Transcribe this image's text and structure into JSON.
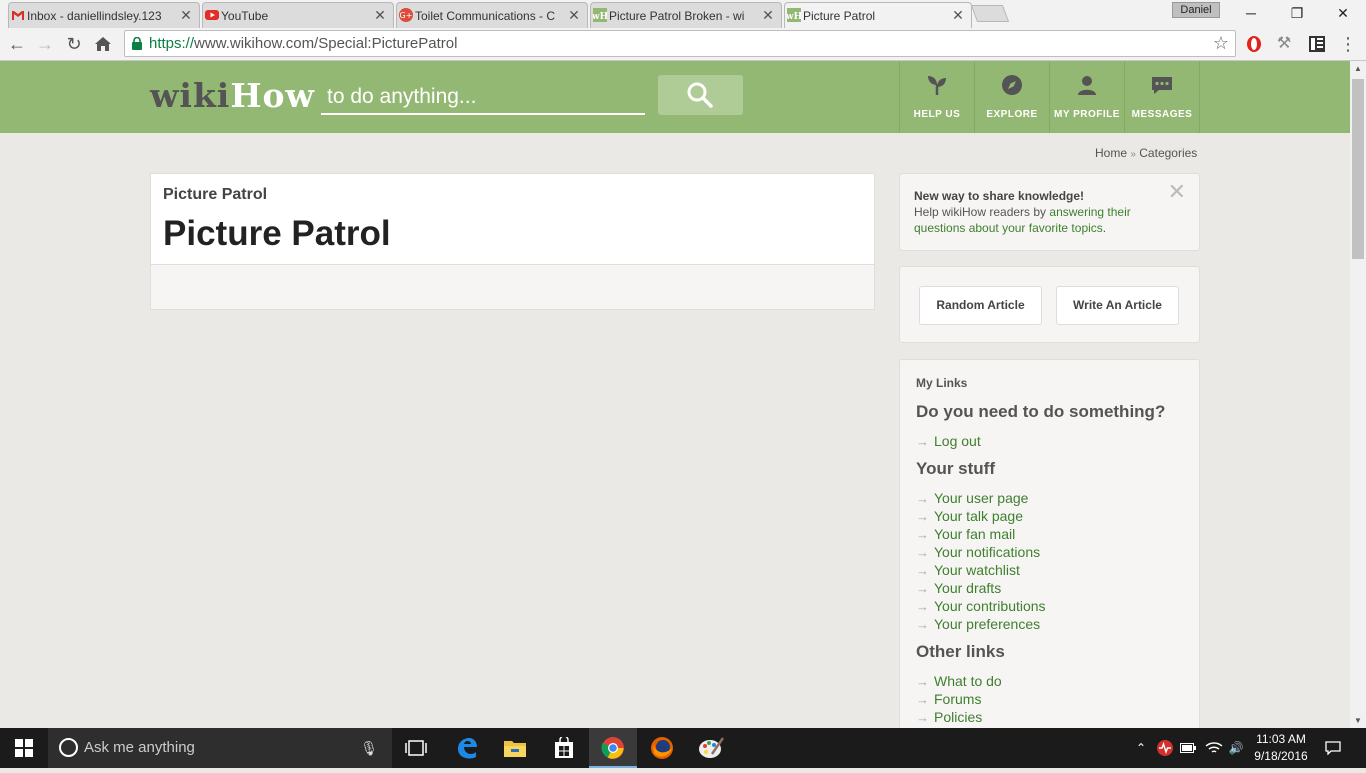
{
  "browser": {
    "tabs": [
      {
        "title": "Inbox - daniellindsley.123",
        "favicon": "gmail-icon",
        "active": false
      },
      {
        "title": "YouTube",
        "favicon": "youtube-icon",
        "active": false
      },
      {
        "title": "Toilet Communications - C",
        "favicon": "google-plus-icon",
        "active": false
      },
      {
        "title": "Picture Patrol Broken - wi",
        "favicon": "wikihow-icon",
        "active": false
      },
      {
        "title": "Picture Patrol",
        "favicon": "wikihow-icon",
        "active": true
      }
    ],
    "profile_name": "Daniel",
    "url_secure": "https://",
    "url_rest": "www.wikihow.com/Special:PicturePatrol"
  },
  "header": {
    "logo_part1": "wiki",
    "logo_part2": "How",
    "search_placeholder": "to do anything...",
    "nav": [
      {
        "label": "HELP US",
        "icon": "sprout-icon"
      },
      {
        "label": "EXPLORE",
        "icon": "compass-icon"
      },
      {
        "label": "MY PROFILE",
        "icon": "person-icon"
      },
      {
        "label": "MESSAGES",
        "icon": "chat-bubble-icon"
      }
    ],
    "brand_color": "#93b874"
  },
  "breadcrumb": {
    "home": "Home",
    "separator": "»",
    "categories": "Categories"
  },
  "main": {
    "crumb_title": "Picture Patrol",
    "title": "Picture Patrol"
  },
  "sidebar": {
    "notice": {
      "heading": "New way to share knowledge!",
      "text_before": "Help wikiHow readers by ",
      "link": "answering their questions about your favorite topics",
      "text_after": "."
    },
    "buttons": {
      "random": "Random Article",
      "write": "Write An Article"
    },
    "links": {
      "section_title": "My Links",
      "need_heading": "Do you need to do something?",
      "need_items": [
        "Log out"
      ],
      "stuff_heading": "Your stuff",
      "stuff_items": [
        "Your user page",
        "Your talk page",
        "Your fan mail",
        "Your notifications",
        "Your watchlist",
        "Your drafts",
        "Your contributions",
        "Your preferences"
      ],
      "other_heading": "Other links",
      "other_items": [
        "What to do",
        "Forums",
        "Policies"
      ]
    }
  },
  "taskbar": {
    "search_placeholder": "Ask me anything",
    "time": "11:03 AM",
    "date": "9/18/2016"
  }
}
